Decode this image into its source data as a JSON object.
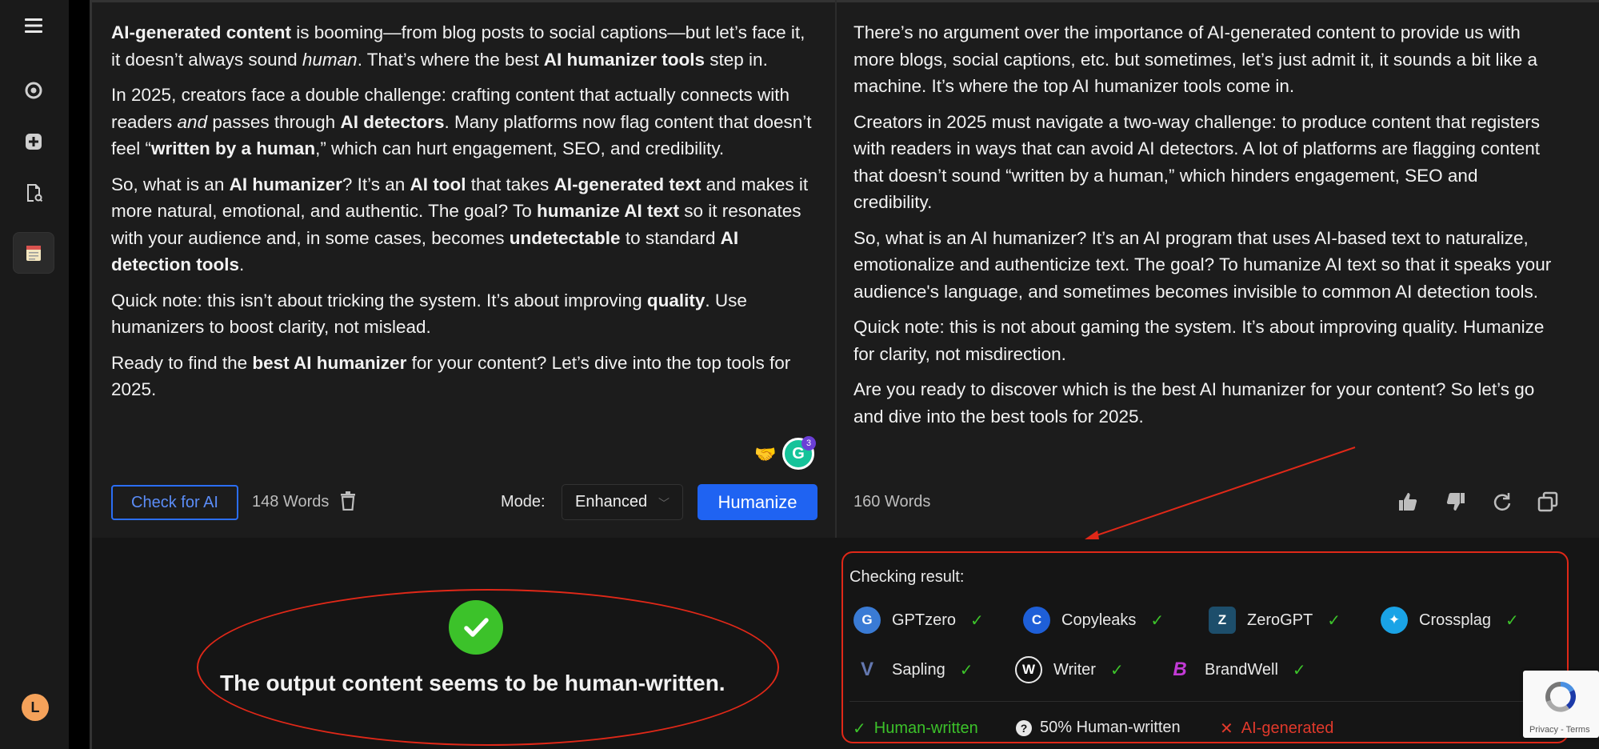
{
  "left_panel": {
    "paragraphs": [
      [
        {
          "t": "AI-generated content",
          "b": true
        },
        {
          "t": " is booming—from blog posts to social captions—but let’s face it, it doesn’t always sound "
        },
        {
          "t": "human",
          "i": true
        },
        {
          "t": ". That’s where the best "
        },
        {
          "t": "AI humanizer tools",
          "b": true
        },
        {
          "t": " step in."
        }
      ],
      [
        {
          "t": "In 2025, creators face a double challenge: crafting content that actually connects with readers "
        },
        {
          "t": "and",
          "i": true
        },
        {
          "t": " passes through "
        },
        {
          "t": "AI detectors",
          "b": true
        },
        {
          "t": ". Many platforms now flag content that doesn’t feel “"
        },
        {
          "t": "written by a human",
          "b": true
        },
        {
          "t": ",” which can hurt engagement, SEO, and credibility."
        }
      ],
      [
        {
          "t": "So, what is an "
        },
        {
          "t": "AI humanizer",
          "b": true
        },
        {
          "t": "? It’s an "
        },
        {
          "t": "AI tool",
          "b": true
        },
        {
          "t": " that takes "
        },
        {
          "t": "AI-generated text",
          "b": true
        },
        {
          "t": " and makes it more natural, emotional, and authentic. The goal? To "
        },
        {
          "t": "humanize AI text",
          "b": true
        },
        {
          "t": " so it resonates with your audience and, in some cases, becomes "
        },
        {
          "t": "undetectable",
          "b": true
        },
        {
          "t": " to standard "
        },
        {
          "t": "AI detection tools",
          "b": true
        },
        {
          "t": "."
        }
      ],
      [
        {
          "t": "Quick note: this isn’t about tricking the system. It’s about improving "
        },
        {
          "t": "quality",
          "b": true
        },
        {
          "t": ". Use humanizers to boost clarity, not mislead."
        }
      ],
      [
        {
          "t": "Ready to find the "
        },
        {
          "t": "best AI humanizer",
          "b": true
        },
        {
          "t": " for your content? Let’s dive into the top tools for 2025."
        }
      ]
    ],
    "check_button": "Check for AI",
    "word_count": "148 Words",
    "mode_label": "Mode:",
    "mode_value": "Enhanced",
    "humanize_button": "Humanize",
    "grammarly_count": "3"
  },
  "right_panel": {
    "paragraphs": [
      "There’s no argument over the importance of AI-generated content to  provide us with more blogs, social captions, etc. but sometimes, let’s just admit it, it sounds a bit like a machine. It’s where the top AI humanizer tools come  in.",
      "Creators  in 2025 must navigate a two-way challenge: to produce content that registers with readers in ways that can avoid AI detectors. A lot of platforms are flagging  content that doesn’t sound “written by a human,” which hinders engagement, SEO and credibility.",
      "So, what is an AI humanizer? It’s an AI program that uses AI-based text to naturalize, emotionalize  and authenticize text. The goal? To humanize AI text so that it speaks your audience's language, and sometimes becomes invisible to common AI detection tools.",
      "Quick note: this is not about  gaming the system. It’s about improving quality. Humanize for clarity, not  misdirection.",
      "Are you ready to discover which  is the best AI humanizer for your content? So let’s go and dive into  the best tools for 2025."
    ],
    "word_count": "160 Words"
  },
  "output": {
    "message": "The output content seems to be human-written."
  },
  "checking": {
    "title": "Checking result:",
    "detectors": [
      {
        "name": "GPTzero",
        "logo": "G",
        "color": "#3a7bd5"
      },
      {
        "name": "Copyleaks",
        "logo": "C",
        "color": "#1e5fd8"
      },
      {
        "name": "ZeroGPT",
        "logo": "Z",
        "color": "#1d4e6b"
      },
      {
        "name": "Crossplag",
        "logo": "✦",
        "color": "#1aa3e6"
      },
      {
        "name": "Sapling",
        "logo": "V",
        "color": "#2c3e63"
      },
      {
        "name": "Writer",
        "logo": "W",
        "color": "#111111"
      },
      {
        "name": "BrandWell",
        "logo": "B",
        "color": "#a02ad6"
      }
    ],
    "legend": {
      "human": "Human-written",
      "half": "50% Human-written",
      "ai": "AI-generated"
    }
  },
  "recaptcha": {
    "text": "Privacy - Terms"
  },
  "user": {
    "initial": "L"
  },
  "colors": {
    "accent": "#1f63f2",
    "success": "#3cc22a",
    "danger": "#e0392b",
    "annotation": "#e02818"
  }
}
